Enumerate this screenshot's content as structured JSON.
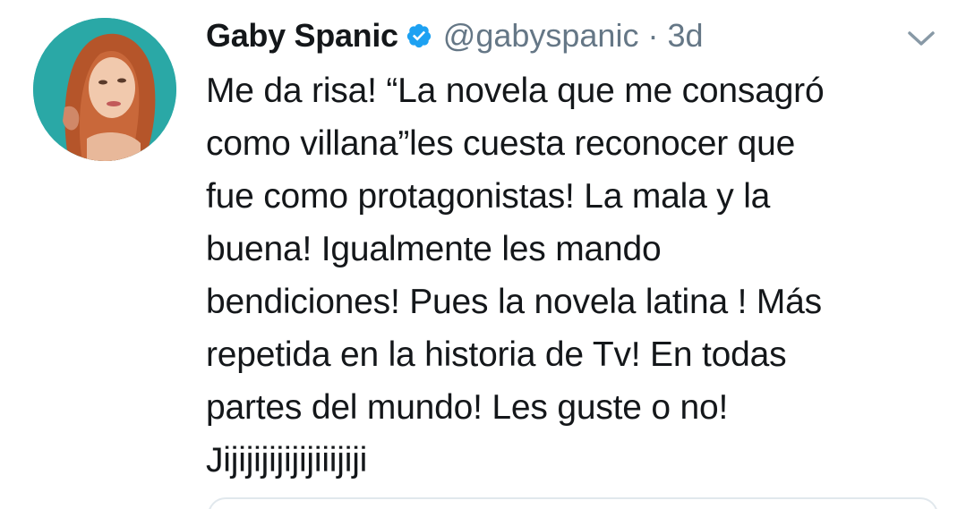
{
  "tweet": {
    "author_name": "Gaby Spanic",
    "handle": "@gabyspanic",
    "separator": "·",
    "time": "3d",
    "verified": true,
    "icons": {
      "verified": "verified-badge-icon",
      "menu": "chevron-down-icon"
    },
    "lines": [
      "Me da risa! “La novela que me consagró",
      "como villana”les cuesta reconocer que",
      "fue como protagonistas! La mala y la",
      "buena! Igualmente les mando",
      "bendiciones! Pues la novela latina ! Más",
      "repetida en la historia de Tv! En todas",
      "partes del mundo! Les guste o no!",
      "Jijijijijijijiiijiji"
    ]
  },
  "colors": {
    "text": "#14171a",
    "secondary": "#657786",
    "verified": "#1da1f2",
    "avatar_bg": "#2aa8a6"
  }
}
